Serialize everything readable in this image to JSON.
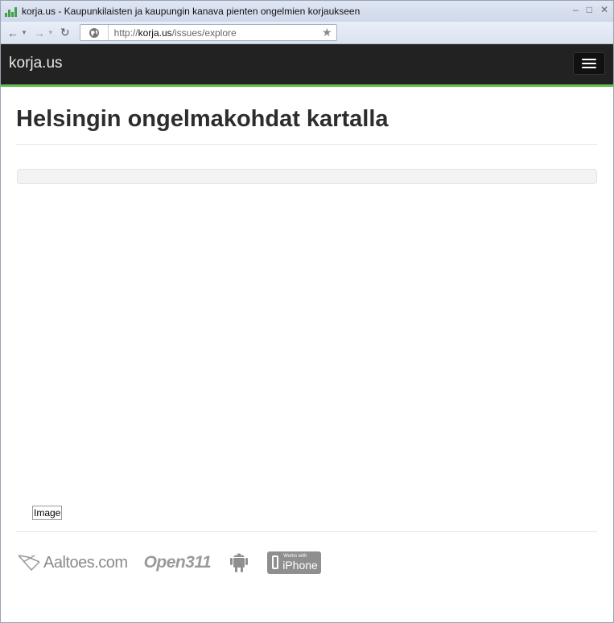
{
  "window": {
    "title": "korja.us - Kaupunkilaisten ja kaupungin kanava pienten ongelmien korjaukseen",
    "controls": [
      "–",
      "□",
      "✕"
    ]
  },
  "browser": {
    "url_prefix": "http://",
    "url_host": "korja.us",
    "url_path": "/issues/explore"
  },
  "site": {
    "brand": "korja.us",
    "page_title": "Helsingin ongelmakohdat kartalla",
    "image_placeholder": "Image"
  },
  "footer": {
    "aaltoes": "Aaltoes.com",
    "open311": "Open311",
    "iphone_small": "Works with",
    "iphone_big": "iPhone"
  },
  "colors": {
    "navbar_bg": "#222222",
    "accent_green": "#5fbf4b"
  },
  "icons": {
    "back": "arrow-left-icon",
    "forward": "arrow-right-icon",
    "reload": "reload-icon",
    "globe": "globe-icon",
    "bookmark": "star-icon",
    "menu": "hamburger-icon",
    "android": "android-icon"
  }
}
